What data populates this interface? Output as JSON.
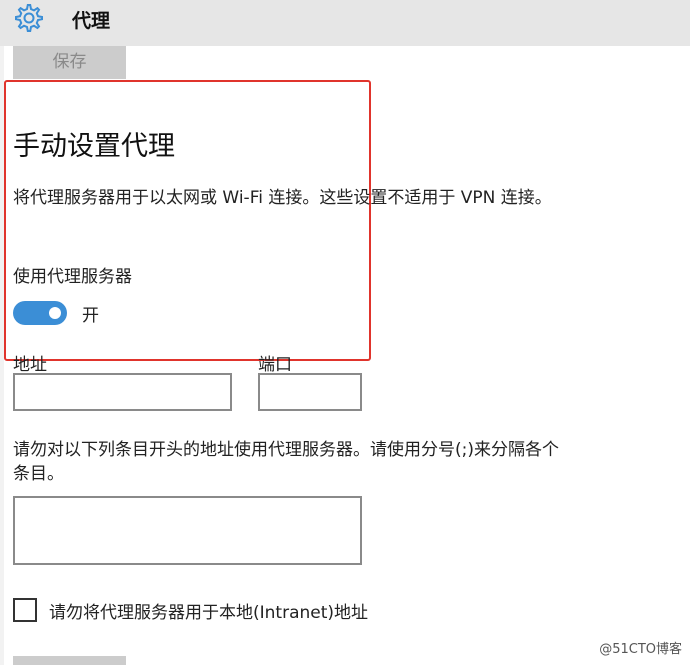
{
  "header": {
    "title": "代理",
    "icon": "gear-icon"
  },
  "toolbar": {
    "save_label": "保存"
  },
  "manual_proxy": {
    "heading": "手动设置代理",
    "description": "将代理服务器用于以太网或 Wi-Fi 连接。这些设置不适用于 VPN 连接。",
    "use_proxy_label": "使用代理服务器",
    "toggle_state_label": "开",
    "toggle_on": true
  },
  "fields": {
    "address_label": "地址",
    "address_value": "",
    "port_label": "端口",
    "port_value": "",
    "exceptions_description": "请勿对以下列条目开头的地址使用代理服务器。请使用分号(;)来分隔各个条目。",
    "exceptions_value": "",
    "local_bypass_label": "请勿将代理服务器用于本地(Intranet)地址",
    "local_bypass_checked": false
  },
  "watermark": "@51CTO博客",
  "colors": {
    "accent": "#3b8ed6",
    "highlight_border": "#e0342c",
    "titlebar_bg": "#e6e6e6",
    "button_bg": "#cccccc"
  }
}
